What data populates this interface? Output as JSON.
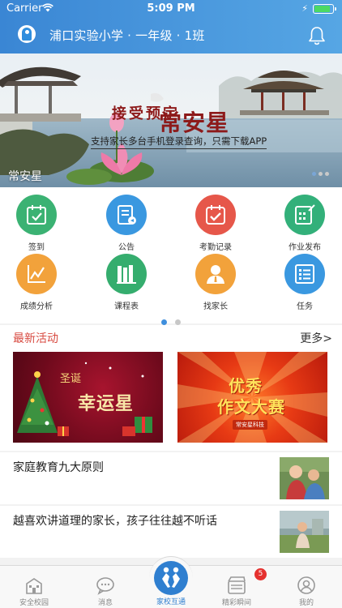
{
  "status_bar": {
    "carrier": "Carrier",
    "time": "5:09 PM"
  },
  "header": {
    "title": "浦口实验小学 · 一年级 · 1班"
  },
  "banner": {
    "slogan": "接受预定",
    "brand": "常安星",
    "subtitle": "支持家长多台手机登录查询，只需下载APP",
    "caption": "常安星"
  },
  "functions": [
    {
      "label": "签到",
      "color": "#3bb273",
      "icon": "checkin-icon"
    },
    {
      "label": "公告",
      "color": "#3a98e0",
      "icon": "announcement-icon"
    },
    {
      "label": "考勤记录",
      "color": "#e6574a",
      "icon": "attendance-icon"
    },
    {
      "label": "作业发布",
      "color": "#33b07a",
      "icon": "homework-icon"
    },
    {
      "label": "成绩分析",
      "color": "#f2a23b",
      "icon": "score-chart-icon"
    },
    {
      "label": "课程表",
      "color": "#35ad6e",
      "icon": "timetable-icon"
    },
    {
      "label": "找家长",
      "color": "#f2a23b",
      "icon": "parent-icon"
    },
    {
      "label": "任务",
      "color": "#3a98e0",
      "icon": "task-icon"
    }
  ],
  "activities": {
    "title": "最新活动",
    "more": "更多>",
    "cards": [
      {
        "line1": "圣诞",
        "line2": "幸运星"
      },
      {
        "line1": "优秀",
        "line2": "作文大赛",
        "tag": "常安星科技"
      }
    ]
  },
  "articles": [
    {
      "title": "家庭教育九大原则"
    },
    {
      "title": "越喜欢讲道理的家长，孩子往往越不听话"
    }
  ],
  "tabbar": {
    "tabs": [
      {
        "label": "安全校园",
        "icon": "school-icon"
      },
      {
        "label": "消息",
        "icon": "message-icon"
      },
      {
        "label": "家校互通",
        "icon": "home-school-icon"
      },
      {
        "label": "精彩瞬间",
        "icon": "video-icon"
      },
      {
        "label": "我的",
        "icon": "profile-icon"
      }
    ],
    "badge": "5"
  },
  "colors": {
    "primary": "#3a86d4",
    "accent_red": "#d84a40"
  }
}
